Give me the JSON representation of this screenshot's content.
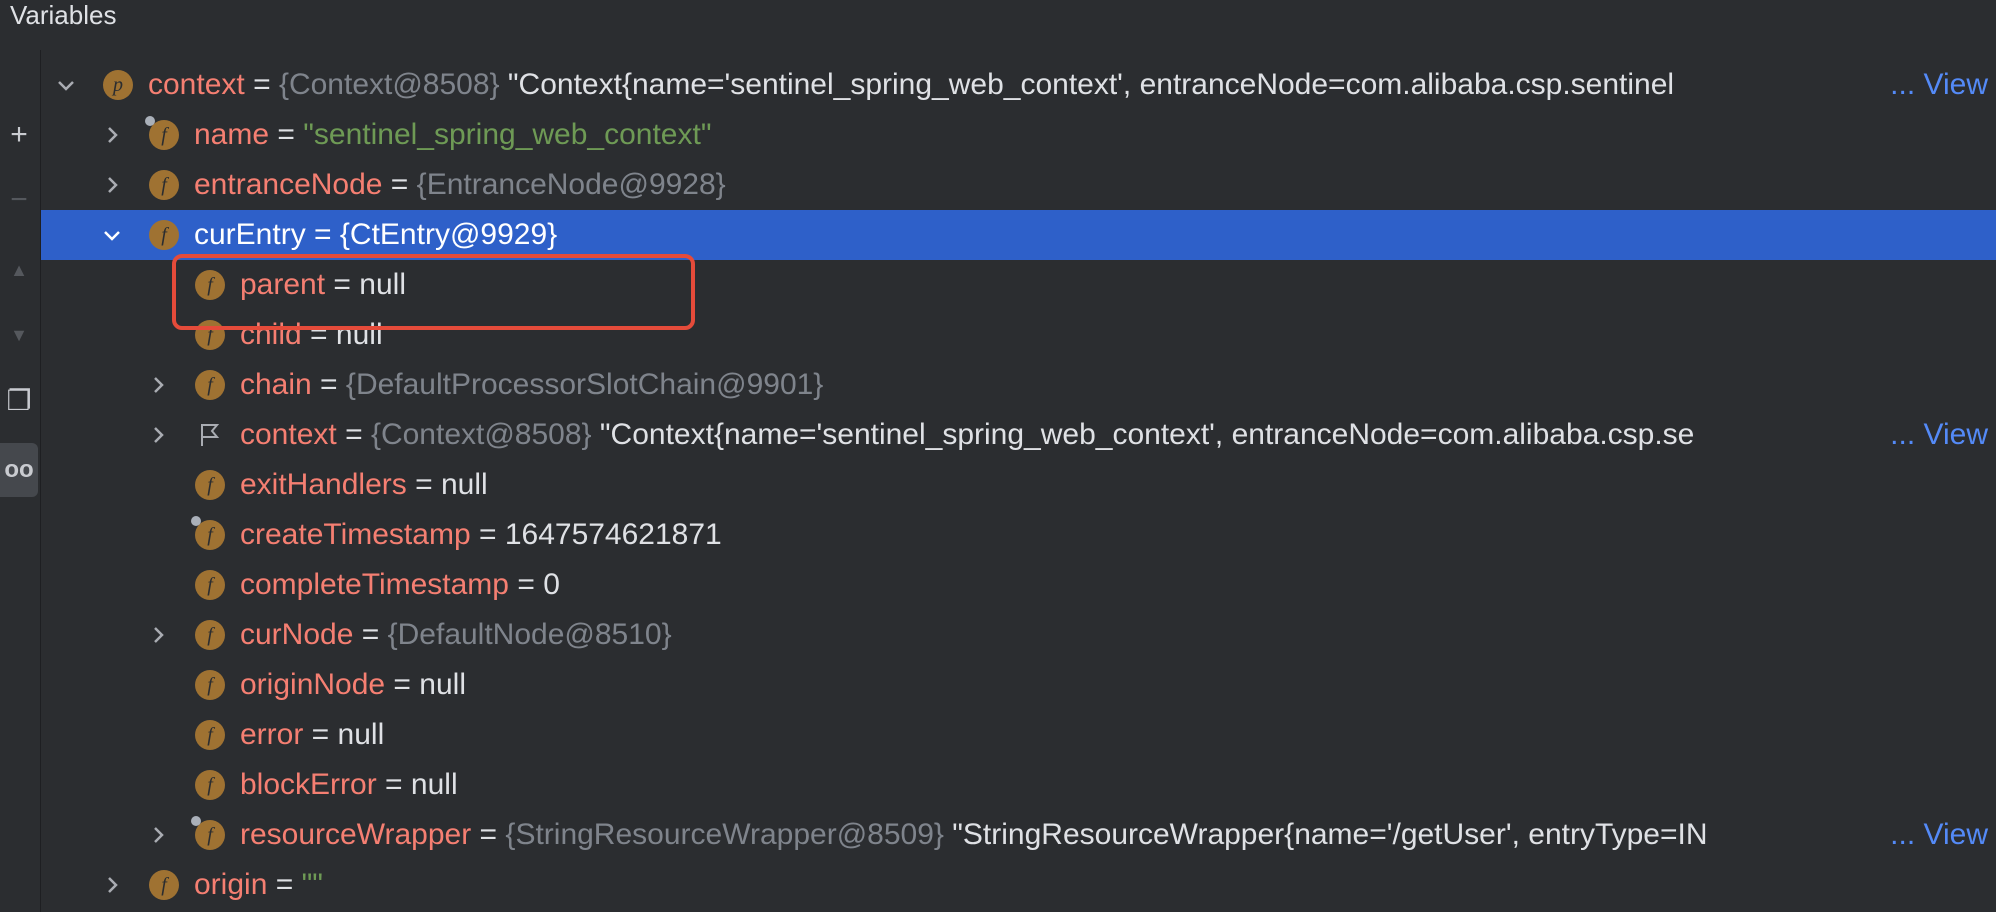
{
  "panel": {
    "title": "Variables"
  },
  "toolbar": {
    "buttons": [
      {
        "icon": "plus-icon",
        "glyph": "+"
      },
      {
        "icon": "minus-icon",
        "glyph": "−"
      },
      {
        "icon": "arrow-up-icon",
        "glyph": "▲"
      },
      {
        "icon": "arrow-down-icon",
        "glyph": "▼"
      },
      {
        "icon": "copy-icon",
        "glyph": "❐"
      },
      {
        "icon": "glasses-icon",
        "glyph": "oo"
      }
    ]
  },
  "rows": {
    "context": {
      "name": "context",
      "badge": "p",
      "type": "{Context@8508}",
      "value": "\"Context{name='sentinel_spring_web_context', entranceNode=com.alibaba.csp.sentinel",
      "more": "... View"
    },
    "name": {
      "name": "name",
      "badge": "f",
      "value": "\"sentinel_spring_web_context\""
    },
    "entranceNode": {
      "name": "entranceNode",
      "badge": "f",
      "type": "{EntranceNode@9928}"
    },
    "curEntry": {
      "name": "curEntry",
      "badge": "f",
      "value": "{CtEntry@9929}"
    },
    "parent": {
      "name": "parent",
      "badge": "f",
      "value": "null"
    },
    "child": {
      "name": "child",
      "badge": "f",
      "value": "null"
    },
    "chain": {
      "name": "chain",
      "badge": "f",
      "type": "{DefaultProcessorSlotChain@9901}"
    },
    "context2": {
      "name": "context",
      "type": "{Context@8508}",
      "value": "\"Context{name='sentinel_spring_web_context', entranceNode=com.alibaba.csp.se",
      "more": "... View"
    },
    "exitHandlers": {
      "name": "exitHandlers",
      "badge": "f",
      "value": "null"
    },
    "createTimestamp": {
      "name": "createTimestamp",
      "badge": "f",
      "value": "1647574621871"
    },
    "completeTimestamp": {
      "name": "completeTimestamp",
      "badge": "f",
      "value": "0"
    },
    "curNode": {
      "name": "curNode",
      "badge": "f",
      "type": "{DefaultNode@8510}"
    },
    "originNode": {
      "name": "originNode",
      "badge": "f",
      "value": "null"
    },
    "error": {
      "name": "error",
      "badge": "f",
      "value": "null"
    },
    "blockError": {
      "name": "blockError",
      "badge": "f",
      "value": "null"
    },
    "resourceWrapper": {
      "name": "resourceWrapper",
      "badge": "f",
      "type": "{StringResourceWrapper@8509}",
      "value": "\"StringResourceWrapper{name='/getUser', entryType=IN",
      "more": "... View"
    },
    "origin": {
      "name": "origin",
      "badge": "f",
      "value": "\"\""
    }
  },
  "colors": {
    "selection": "#2e60c9",
    "highlight_box": "#e54b3a",
    "field_name": "#f57f72",
    "string_value": "#6e9a55"
  }
}
